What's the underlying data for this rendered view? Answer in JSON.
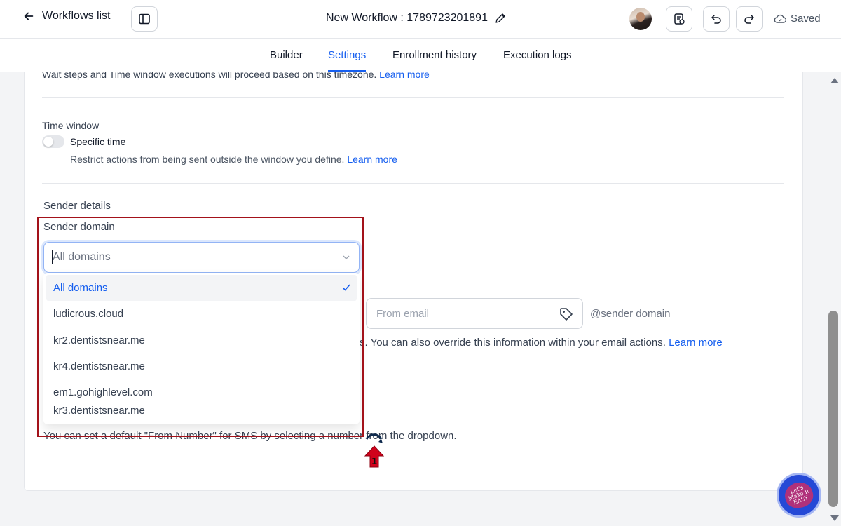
{
  "header": {
    "back_label": "Workflows list",
    "workflow_title": "New Workflow : 1789723201891",
    "status": "Saved"
  },
  "tabs": [
    {
      "label": "Builder",
      "active": false
    },
    {
      "label": "Settings",
      "active": true
    },
    {
      "label": "Enrollment history",
      "active": false
    },
    {
      "label": "Execution logs",
      "active": false
    }
  ],
  "timezone_note": {
    "text": "Wait steps and Time window executions will proceed based on this timezone.",
    "link": "Learn more"
  },
  "time_window": {
    "label": "Time window",
    "toggle_label": "Specific time",
    "toggle_on": false,
    "help": "Restrict actions from being sent outside the window you define.",
    "help_link": "Learn more"
  },
  "sender_details": {
    "title": "Sender details",
    "domain_label": "Sender domain",
    "domain_value": "All domains",
    "options": [
      {
        "label": "All domains",
        "selected": true
      },
      {
        "label": "ludicrous.cloud",
        "selected": false
      },
      {
        "label": "kr2.dentistsnear.me",
        "selected": false
      },
      {
        "label": "kr4.dentistsnear.me",
        "selected": false
      },
      {
        "label": "em1.gohighlevel.com",
        "selected": false
      },
      {
        "label": "kr3.dentistsnear.me",
        "selected": false
      }
    ],
    "from_email_placeholder": "From email",
    "domain_suffix": "@sender domain",
    "override_text": "s. You can also override this information within your email actions.",
    "override_link": "Learn more",
    "sms_text": "You can set a default \"From Number\" for SMS by selecting a number from the dropdown."
  },
  "step_marker": "1",
  "badge_text": "Let's Make It EASY",
  "colors": {
    "accent": "#155eef",
    "highlight_border": "#a3121a",
    "step_marker": "#d0021b",
    "badge_bg": "#2549d6"
  }
}
